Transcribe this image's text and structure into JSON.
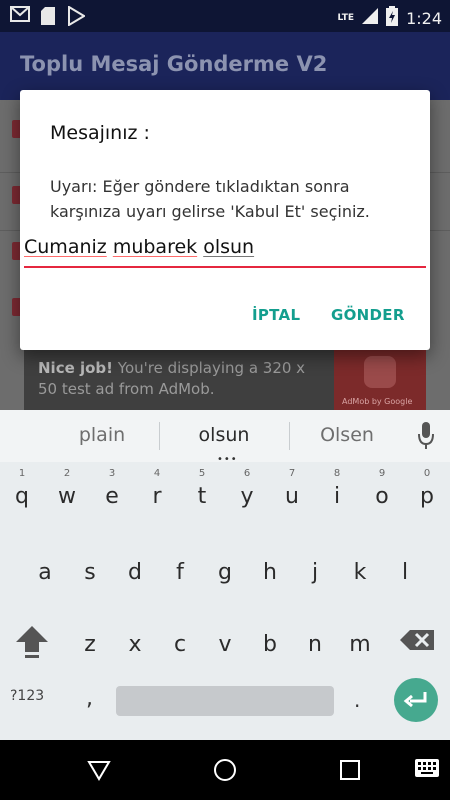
{
  "status_bar": {
    "icons_left": [
      "gmail-icon",
      "sd-card-icon",
      "play-store-icon"
    ],
    "network": "LTE",
    "time": "1:24"
  },
  "toolbar": {
    "title": "Toplu Mesaj Gönderme V2"
  },
  "background_ad": {
    "bold": "Nice job!",
    "text": " You're displaying a 320 x 50 test ad from AdMob.",
    "logo_text": "AdMob by Google"
  },
  "dialog": {
    "title": "Mesajınız :",
    "message": "Uyarı: Eğer göndere tıkladıktan sonra karşınıza uyarı gelirse 'Kabul Et' seçiniz.",
    "input_words": [
      "Cumaniz",
      "mubarek",
      "olsun"
    ],
    "cancel_label": "İPTAL",
    "send_label": "GÖNDER",
    "accent_color": "#e5273f",
    "button_color": "#139e8e"
  },
  "keyboard": {
    "suggestions": [
      "plain",
      "olsun",
      "Olsen"
    ],
    "row1": [
      {
        "k": "q",
        "h": "1"
      },
      {
        "k": "w",
        "h": "2"
      },
      {
        "k": "e",
        "h": "3"
      },
      {
        "k": "r",
        "h": "4"
      },
      {
        "k": "t",
        "h": "5"
      },
      {
        "k": "y",
        "h": "6"
      },
      {
        "k": "u",
        "h": "7"
      },
      {
        "k": "i",
        "h": "8"
      },
      {
        "k": "o",
        "h": "9"
      },
      {
        "k": "p",
        "h": "0"
      }
    ],
    "row2": [
      "a",
      "s",
      "d",
      "f",
      "g",
      "h",
      "j",
      "k",
      "l"
    ],
    "row3": [
      "z",
      "x",
      "c",
      "v",
      "b",
      "n",
      "m"
    ],
    "symbols_label": "?123",
    "comma": ",",
    "period": ".",
    "enter_color": "#46a98f"
  }
}
